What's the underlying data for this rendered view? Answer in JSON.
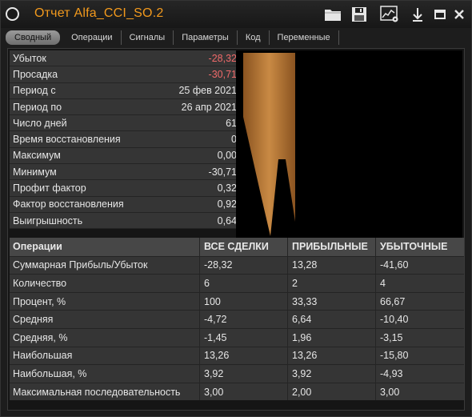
{
  "window": {
    "title": "Отчет Alfa_CCI_SO.2"
  },
  "tabs": [
    {
      "label": "Сводный"
    },
    {
      "label": "Операции"
    },
    {
      "label": "Сигналы"
    },
    {
      "label": "Параметры"
    },
    {
      "label": "Код"
    },
    {
      "label": "Переменные"
    }
  ],
  "summary": [
    {
      "label": "Убыток",
      "value": "-28,32"
    },
    {
      "label": "Просадка",
      "value": "-30,71"
    },
    {
      "label": "Период с",
      "value": "25 фев 2021"
    },
    {
      "label": "Период по",
      "value": "26 апр 2021"
    },
    {
      "label": "Число дней",
      "value": "61"
    },
    {
      "label": "Время восстановления",
      "value": "0"
    },
    {
      "label": "Максимум",
      "value": "0,00"
    },
    {
      "label": "Минимум",
      "value": "-30,71"
    },
    {
      "label": "Профит фактор",
      "value": "0,32"
    },
    {
      "label": "Фактор восстановления",
      "value": "0,92"
    },
    {
      "label": "Выигрышность",
      "value": "0,64"
    }
  ],
  "operations": {
    "headers": [
      "Операции",
      "ВСЕ СДЕЛКИ",
      "ПРИБЫЛЬНЫЕ",
      "УБЫТОЧНЫЕ"
    ],
    "rows": [
      [
        "Суммарная Прибыль/Убыток",
        "-28,32",
        "13,28",
        "-41,60"
      ],
      [
        "Количество",
        "6",
        "2",
        "4"
      ],
      [
        "Процент, %",
        "100",
        "33,33",
        "66,67"
      ],
      [
        "Средняя",
        "-4,72",
        "6,64",
        "-10,40"
      ],
      [
        "Средняя, %",
        "-1,45",
        "1,96",
        "-3,15"
      ],
      [
        "Наибольшая",
        "13,26",
        "13,26",
        "-15,80"
      ],
      [
        "Наибольшая, %",
        "3,92",
        "3,92",
        "-4,93"
      ],
      [
        "Максимальная последовательность",
        "3,00",
        "2,00",
        "3,00"
      ]
    ]
  },
  "colors": {
    "title": "#f39a1d",
    "negative": "#f06a6a",
    "equity_fill": "#b8772e"
  },
  "icons": [
    "folder-icon",
    "save-icon",
    "chart-settings-icon",
    "download-icon",
    "minimize-icon",
    "close-icon"
  ]
}
